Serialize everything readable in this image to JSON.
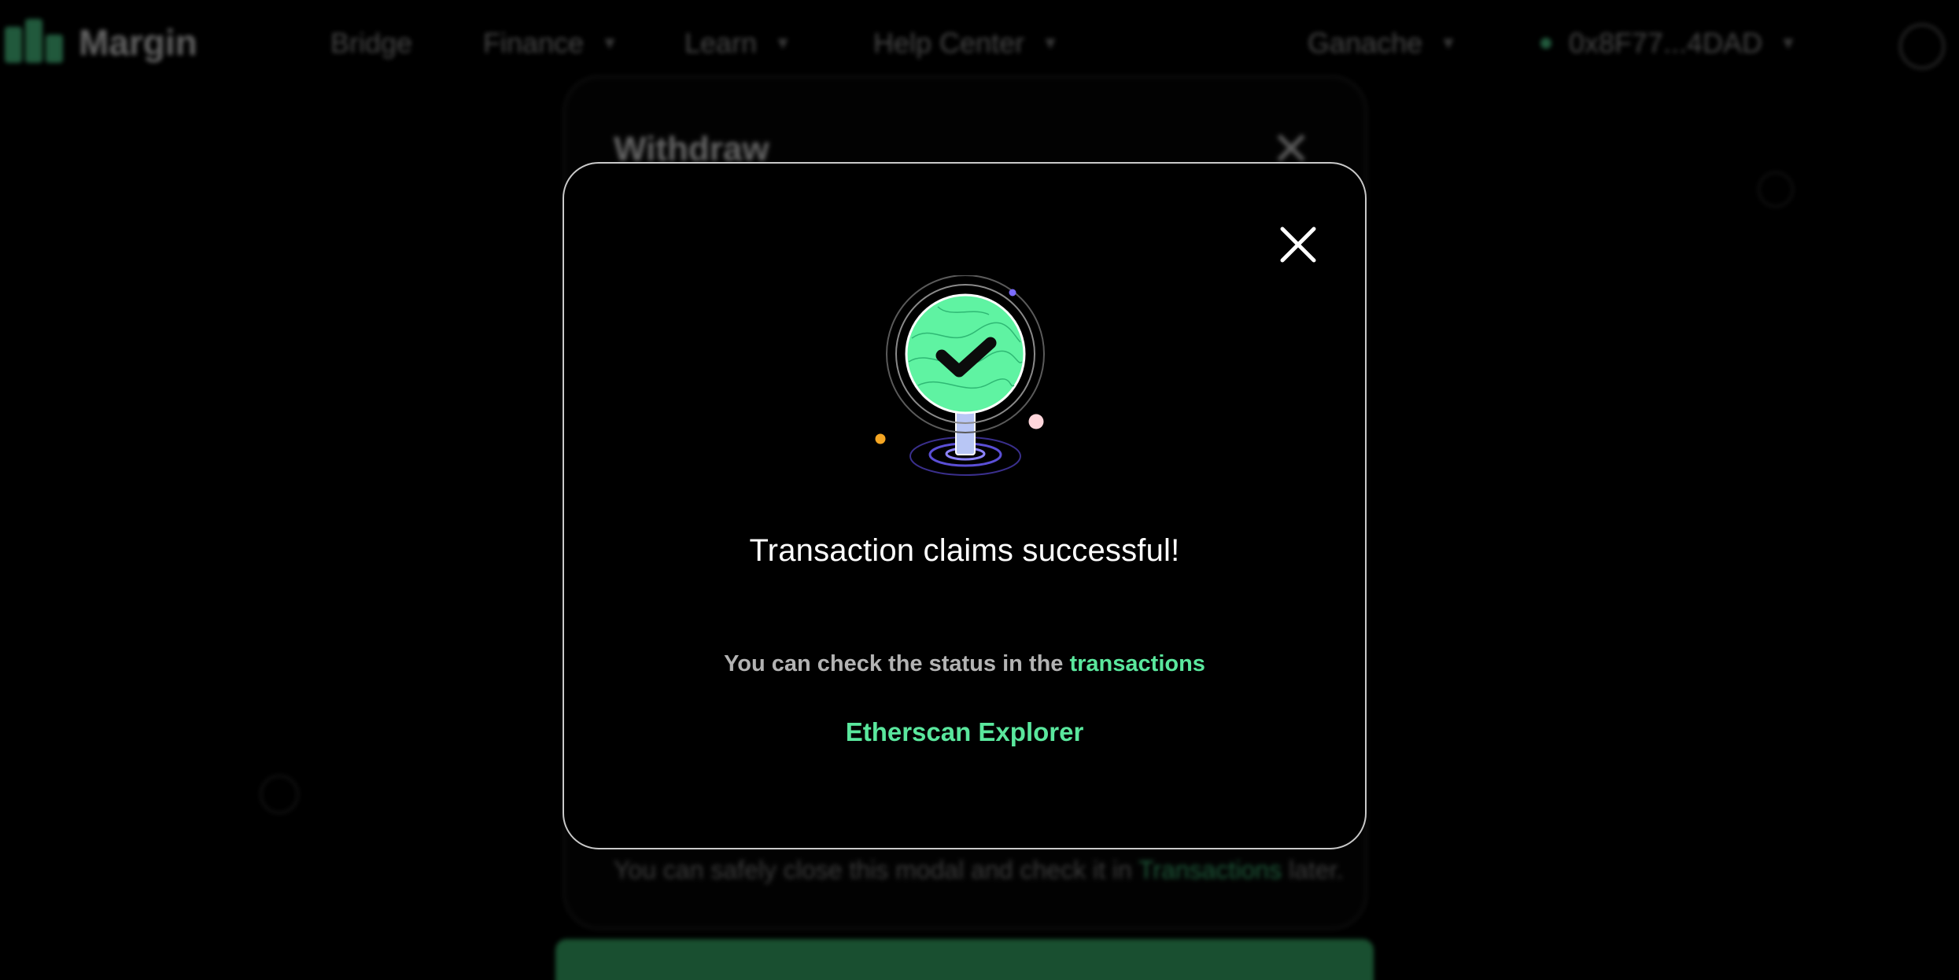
{
  "app": {
    "logo_text": "Margin",
    "nav": [
      {
        "label": "Bridge"
      },
      {
        "label": "Finance"
      },
      {
        "label": "Learn"
      },
      {
        "label": "Help Center"
      }
    ],
    "network": {
      "label": "Ganache"
    },
    "wallet": {
      "address": "0x8F77...4DAD"
    }
  },
  "background_card": {
    "title": "Withdraw",
    "note_prefix": "You can safely close this modal and check it in",
    "note_link": "Transactions",
    "note_suffix": "later."
  },
  "modal": {
    "title": "Transaction claims successful!",
    "status_prefix": "You can check the status in the",
    "status_link": "transactions",
    "explorer_link": "Etherscan Explorer"
  },
  "icons": {
    "close": "close-icon",
    "success": "success-check-icon"
  },
  "colors": {
    "accent_green": "#5ae79d",
    "success_circle": "#5ff3a2",
    "modal_border": "#c9c9c9",
    "dot_purple": "#7b6cff",
    "dot_orange": "#f5a623",
    "dot_pink": "#ffd6db"
  }
}
